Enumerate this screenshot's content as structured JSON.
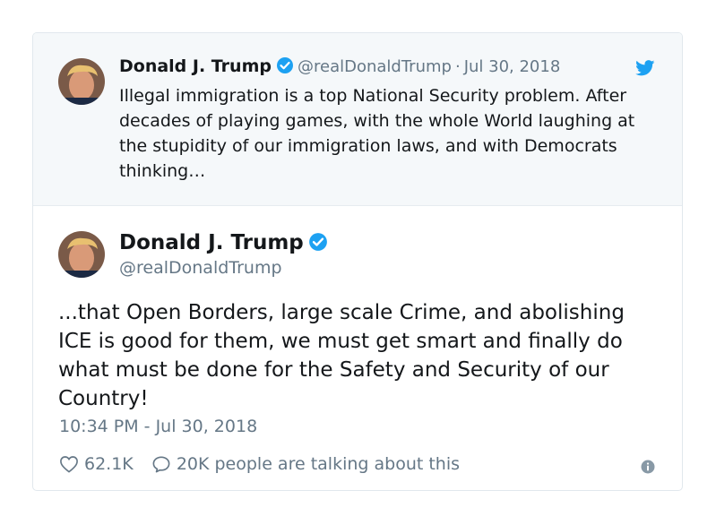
{
  "quoted": {
    "name": "Donald J. Trump",
    "handle": "@realDonaldTrump",
    "separator": "·",
    "date": "Jul 30, 2018",
    "text": "Illegal immigration is a top National Security problem. After decades of playing games, with the whole World laughing at the stupidity of our immigration laws, and with Democrats thinking…"
  },
  "main": {
    "name": "Donald J. Trump",
    "handle": "@realDonaldTrump",
    "text": "...that Open Borders, large scale Crime, and abolishing ICE is good for them, we must get smart and finally do what must be done for the Safety and Security of our Country!",
    "timestamp": "10:34 PM - Jul 30, 2018"
  },
  "actions": {
    "likes": "62.1K",
    "talking": "20K people are talking about this"
  },
  "icons": {
    "verified": "verified-badge-icon",
    "bird": "twitter-bird-icon",
    "heart": "heart-icon",
    "comment": "comment-icon",
    "info": "info-icon"
  },
  "colors": {
    "accent": "#1da1f2",
    "muted": "#657786",
    "quoted_bg": "#f5f8fa"
  }
}
